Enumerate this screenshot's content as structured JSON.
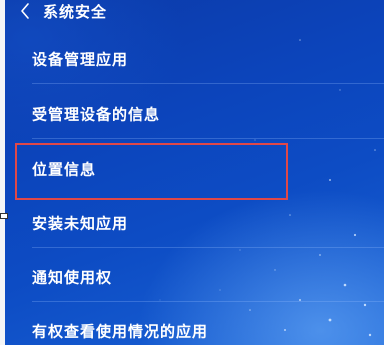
{
  "header": {
    "title": "系统安全",
    "back_icon": "chevron-left-icon"
  },
  "items": [
    {
      "label": "设备管理应用"
    },
    {
      "label": "受管理设备的信息"
    },
    {
      "label": "位置信息",
      "highlighted": true
    },
    {
      "label": "安装未知应用"
    },
    {
      "label": "通知使用权"
    },
    {
      "label": "有权查看使用情况的应用"
    }
  ],
  "colors": {
    "background": "#0c44bb",
    "text": "#ffffff",
    "highlight_border": "#e04848"
  }
}
